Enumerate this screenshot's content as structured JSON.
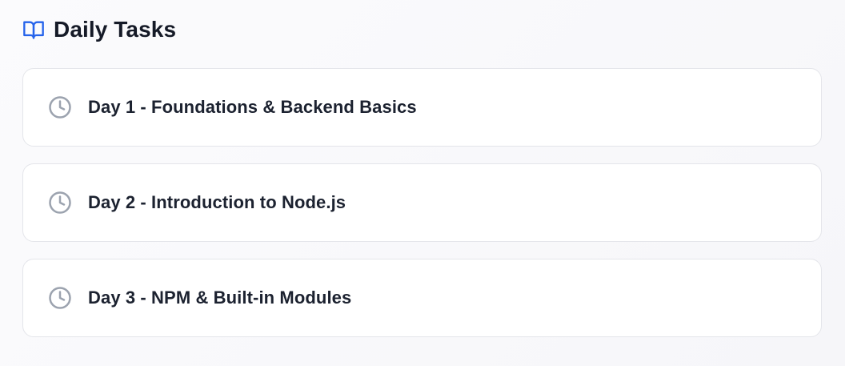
{
  "header": {
    "title": "Daily Tasks",
    "icon": "book-open-icon"
  },
  "tasks": [
    {
      "label": "Day 1 - Foundations & Backend Basics",
      "icon": "clock-icon"
    },
    {
      "label": "Day 2 - Introduction to Node.js",
      "icon": "clock-icon"
    },
    {
      "label": "Day 3 - NPM & Built-in Modules",
      "icon": "clock-icon"
    }
  ],
  "colors": {
    "accent": "#2563eb",
    "icon_muted": "#9ca3af",
    "card_border": "#e4e5ea",
    "text": "#1b1f2a"
  }
}
